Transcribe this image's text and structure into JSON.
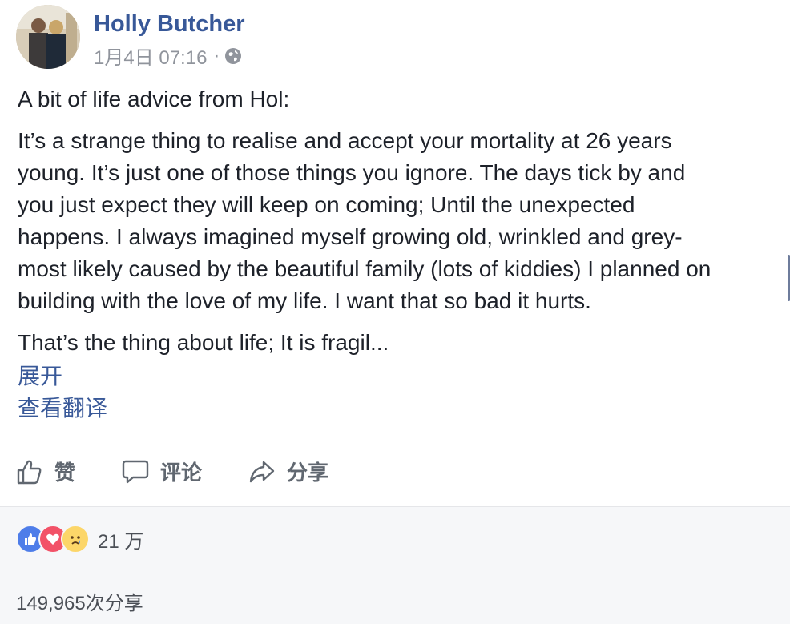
{
  "post": {
    "author": "Holly Butcher",
    "date": "1月4日 07:16",
    "separator": "·",
    "privacy_icon": "globe-icon",
    "paragraph1": "A bit of life advice from Hol:",
    "paragraph2_lines": [
      "It’s a strange thing to realise and accept your mortality at 26 years",
      "young. It’s just one of those things you ignore. The days tick by and",
      "you just expect they will keep on coming; Until the unexpected",
      "happens. I always imagined myself growing old, wrinkled and grey-",
      "most likely caused by the beautiful family (lots of kiddies) I planned on",
      "building with the love of my life. I want that so bad it hurts."
    ],
    "paragraph3": "That’s the thing about life; It is fragil...",
    "expand_label": "展开",
    "translate_label": "查看翻译"
  },
  "actions": {
    "like_label": "赞",
    "comment_label": "评论",
    "share_label": "分享"
  },
  "stats": {
    "reaction_icons": [
      "like-icon",
      "love-icon",
      "sad-icon"
    ],
    "reaction_count": "21 万",
    "share_count": "149,965次分享"
  },
  "colors": {
    "link": "#385898",
    "like": "#4e7de9",
    "love": "#f25268",
    "sad": "#fcd669"
  }
}
